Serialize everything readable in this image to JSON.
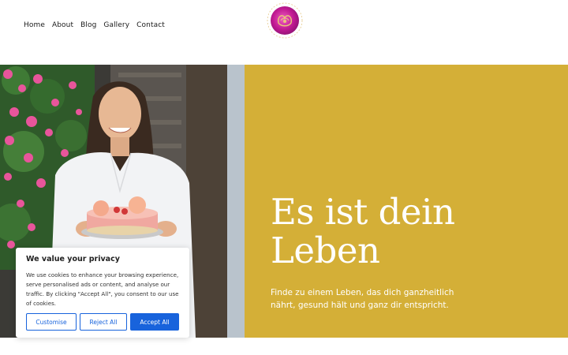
{
  "nav": {
    "items": [
      {
        "label": "Home"
      },
      {
        "label": "About"
      },
      {
        "label": "Blog"
      },
      {
        "label": "Gallery"
      },
      {
        "label": "Contact"
      }
    ]
  },
  "logo": {
    "icon": "rose-gold-logo-icon"
  },
  "hero": {
    "title_line1": "Es ist dein",
    "title_line2": "Leben",
    "subtitle_line1": "Finde zu einem Leben, das dich ganzheitlich",
    "subtitle_line2": "nährt, gesund hält und ganz dir entspricht.",
    "panel_color": "#d4af37"
  },
  "cookie": {
    "title": "We value your privacy",
    "text": "We use cookies to enhance your browsing experience, serve personalised ads or content, and analyse our traffic. By clicking \"Accept All\", you consent to our use of cookies.",
    "customise": "Customise",
    "reject": "Reject All",
    "accept": "Accept All",
    "accent": "#1863dc"
  }
}
